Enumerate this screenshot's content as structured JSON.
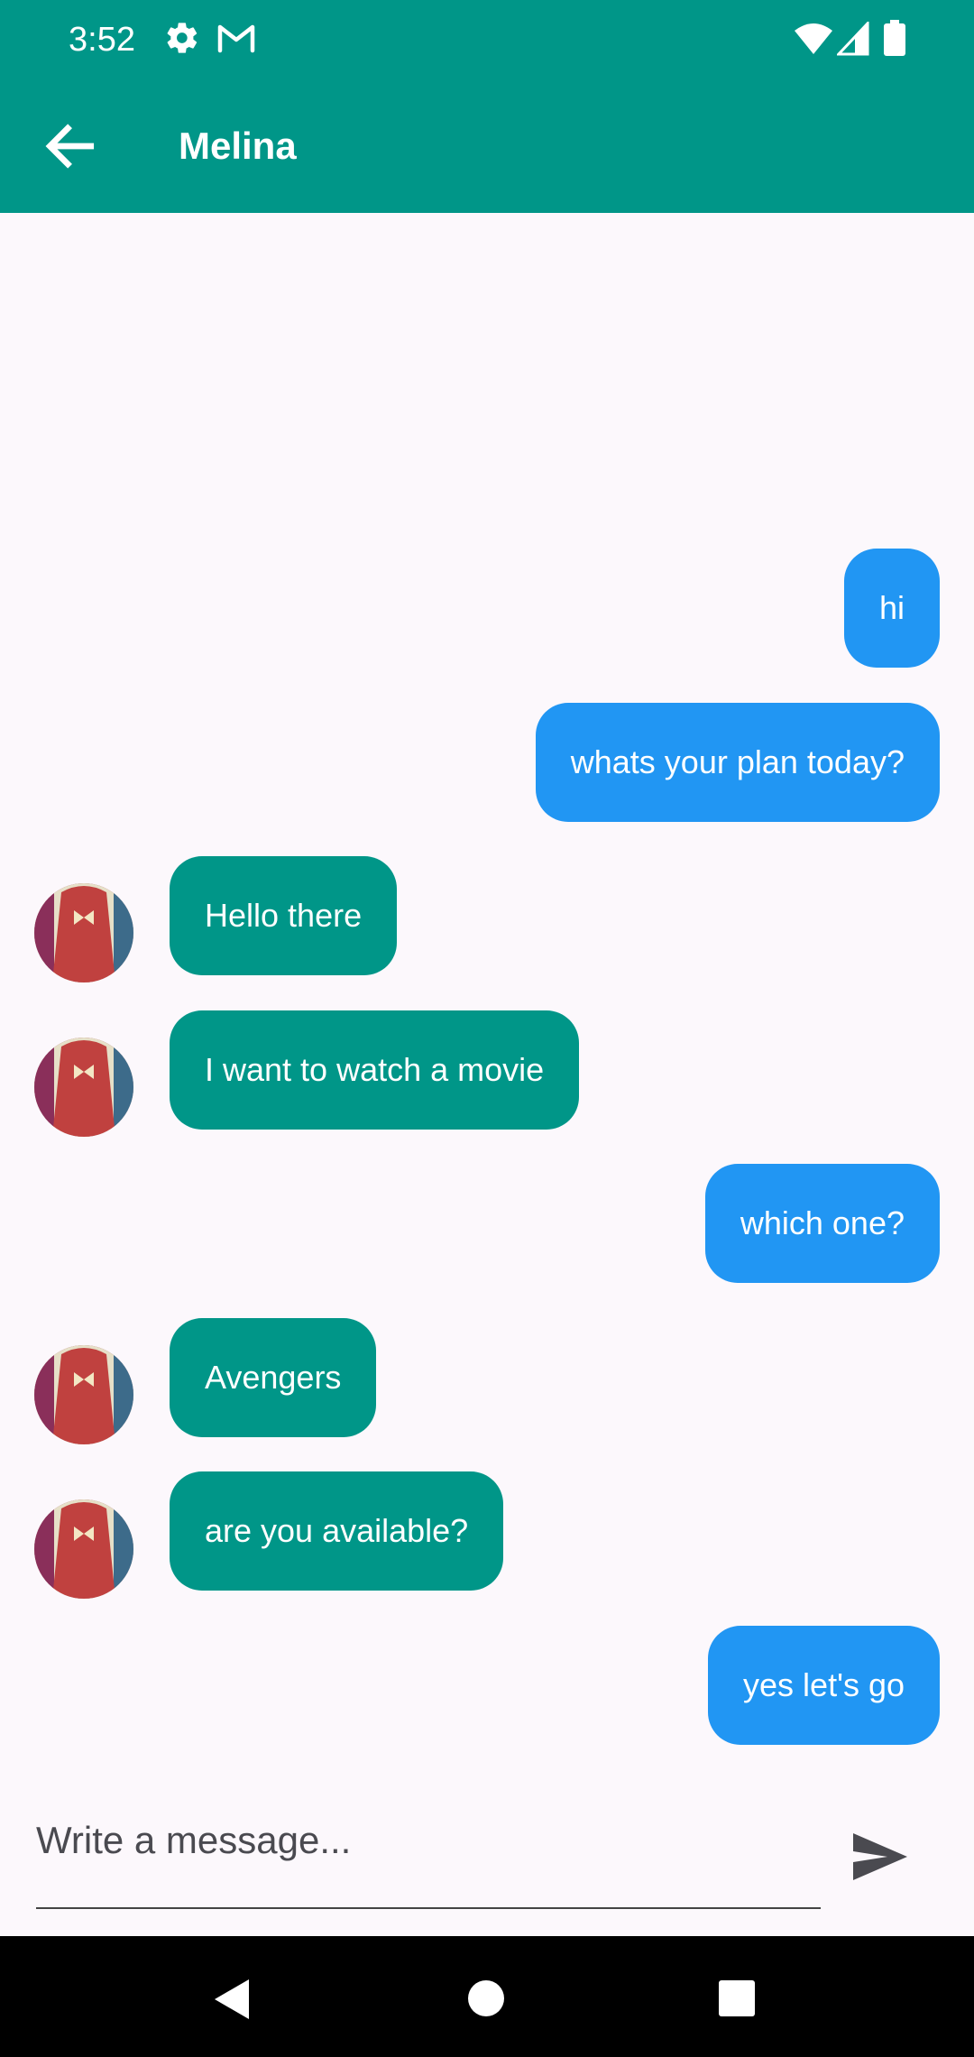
{
  "status_bar": {
    "time": "3:52",
    "icons": [
      "settings-gear-icon",
      "gmail-icon",
      "wifi-icon",
      "signal-icon",
      "battery-icon"
    ]
  },
  "app_bar": {
    "title": "Melina",
    "back_icon": "arrow-back-icon",
    "color": "#009688"
  },
  "colors": {
    "sent_bubble": "#2196f3",
    "received_bubble": "#009688",
    "background": "#fcf8fc"
  },
  "messages": [
    {
      "text": "hi",
      "direction": "sent"
    },
    {
      "text": "whats your plan today?",
      "direction": "sent"
    },
    {
      "text": "Hello there",
      "direction": "received"
    },
    {
      "text": "I want to watch a movie",
      "direction": "received"
    },
    {
      "text": "which one?",
      "direction": "sent"
    },
    {
      "text": "Avengers",
      "direction": "received"
    },
    {
      "text": "are you available?",
      "direction": "received"
    },
    {
      "text": "yes let's go",
      "direction": "sent"
    }
  ],
  "composer": {
    "placeholder": "Write a message...",
    "value": "",
    "send_icon": "send-icon"
  },
  "nav_bar": {
    "icons": [
      "nav-back-icon",
      "nav-home-icon",
      "nav-recents-icon"
    ]
  }
}
